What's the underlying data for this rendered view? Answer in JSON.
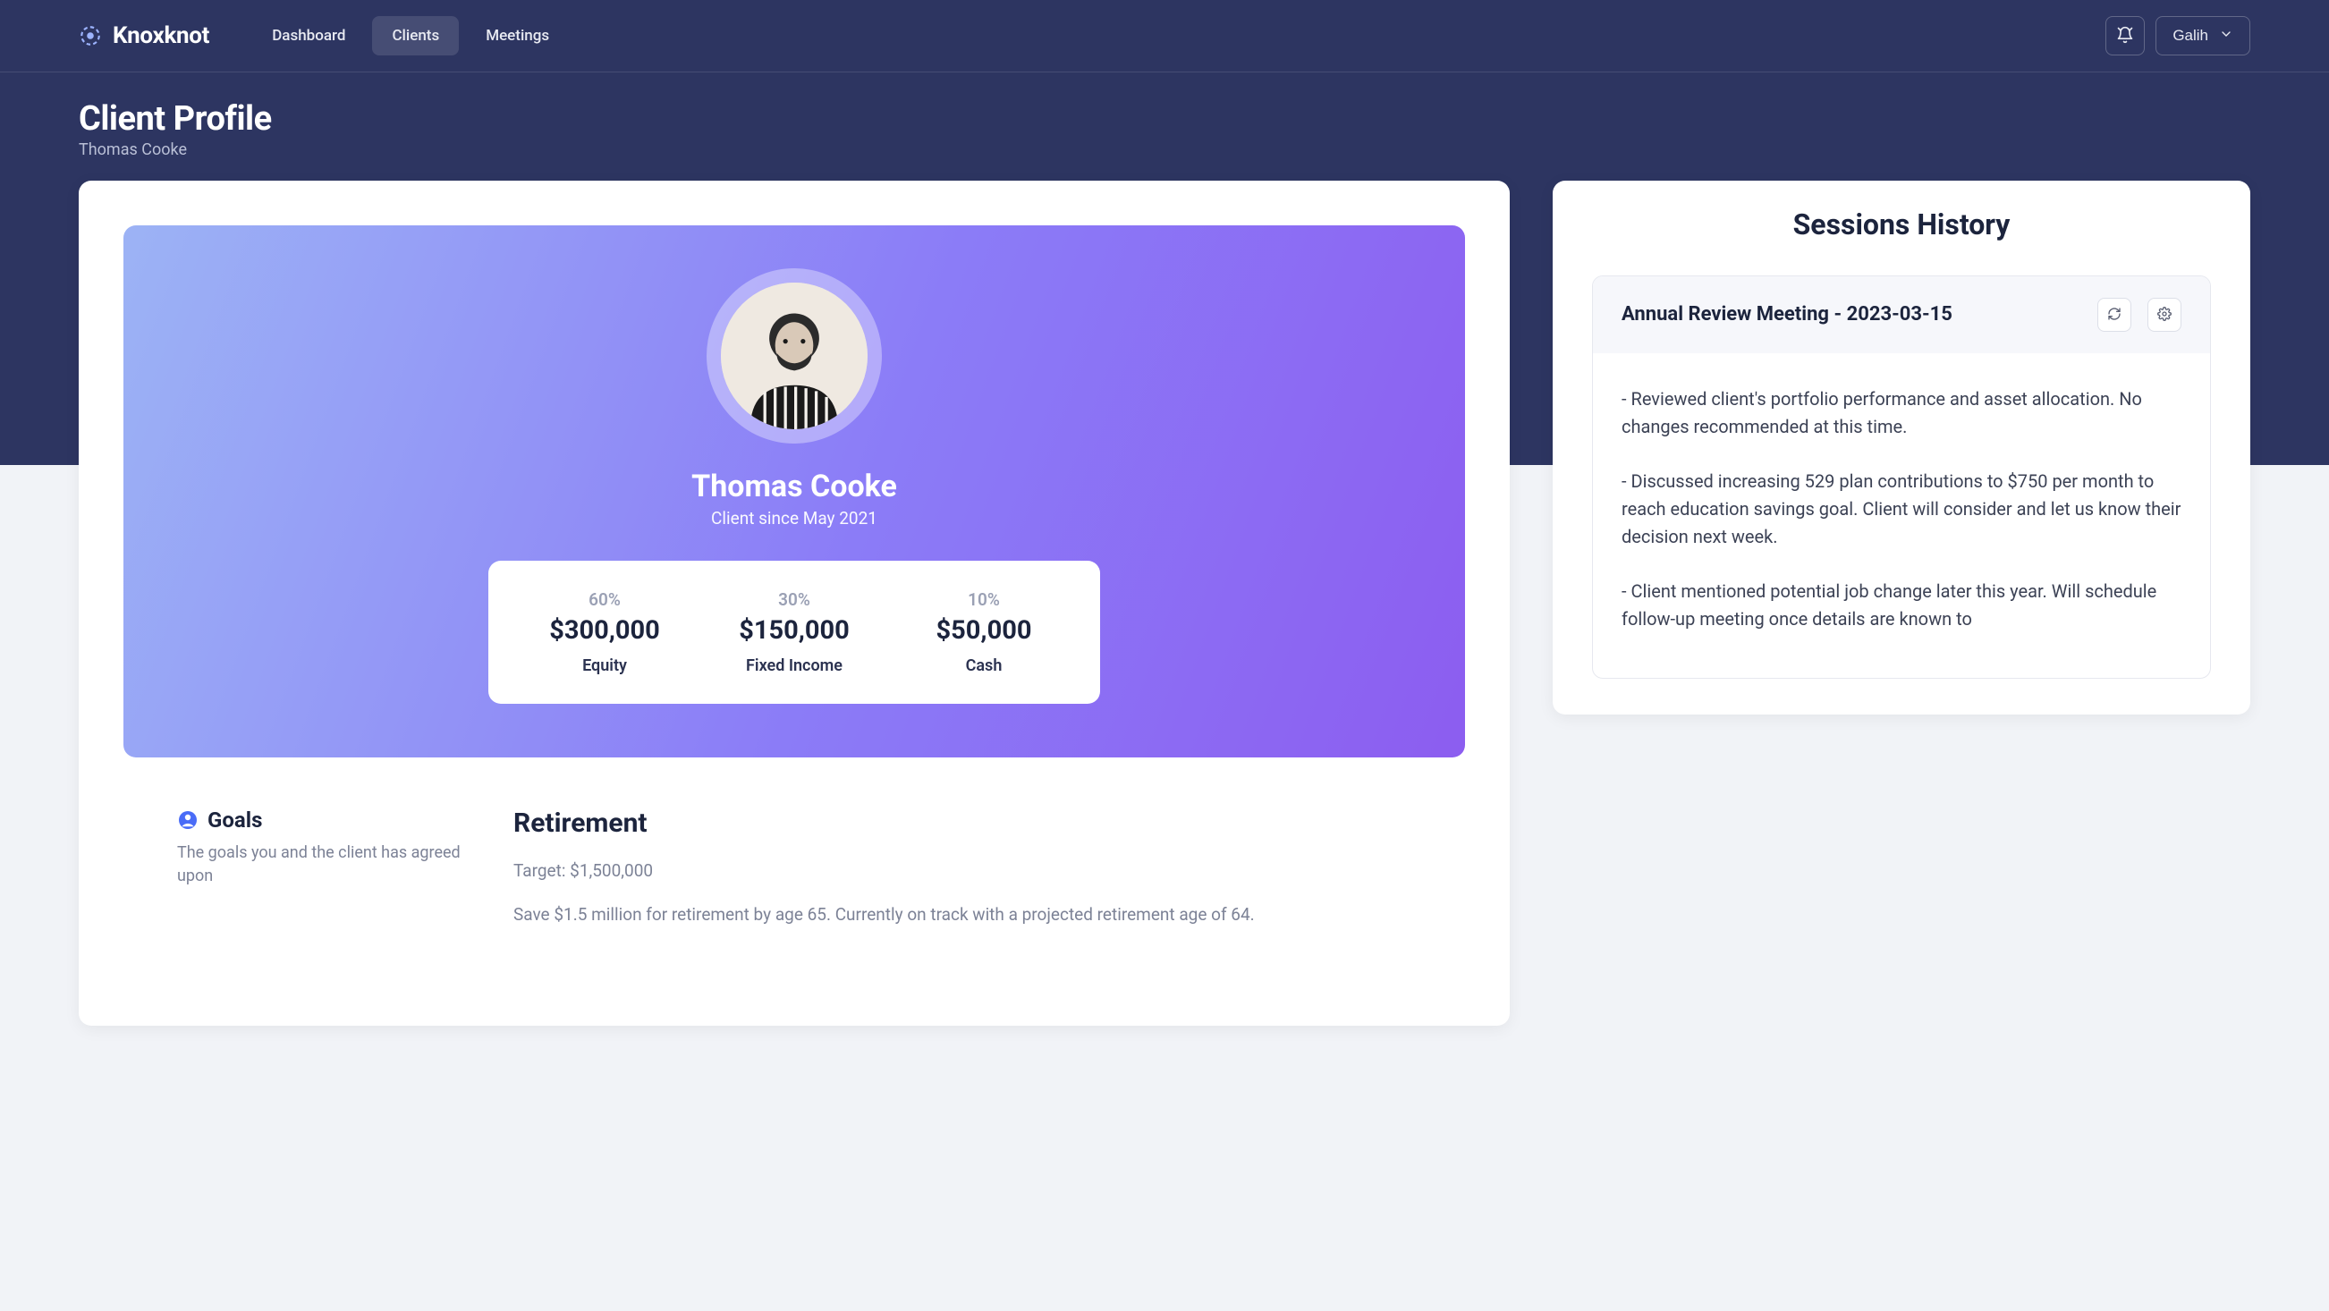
{
  "brand": "Knoxknot",
  "nav": {
    "dashboard": "Dashboard",
    "clients": "Clients",
    "meetings": "Meetings"
  },
  "user": {
    "name": "Galih"
  },
  "page": {
    "title": "Client Profile",
    "subtitle": "Thomas Cooke"
  },
  "client": {
    "name": "Thomas Cooke",
    "since": "Client since May 2021",
    "allocations": [
      {
        "pct": "60%",
        "amount": "$300,000",
        "label": "Equity"
      },
      {
        "pct": "30%",
        "amount": "$150,000",
        "label": "Fixed Income"
      },
      {
        "pct": "10%",
        "amount": "$50,000",
        "label": "Cash"
      }
    ]
  },
  "goals": {
    "section_title": "Goals",
    "section_desc": "The goals you and the client has agreed upon",
    "items": [
      {
        "name": "Retirement",
        "target": "Target: $1,500,000",
        "body": "Save $1.5 million for retirement by age 65. Currently on track with a projected retirement age of 64."
      }
    ]
  },
  "sessions": {
    "title": "Sessions History",
    "items": [
      {
        "title": "Annual Review Meeting - 2023-03-15",
        "notes": [
          "- Reviewed client's portfolio performance and asset allocation. No changes recommended at this time.",
          "- Discussed increasing 529 plan contributions to $750 per month to reach education savings goal. Client will consider and let us know their decision next week.",
          "- Client mentioned potential job change later this year. Will schedule follow-up meeting once details are known to"
        ]
      }
    ]
  }
}
